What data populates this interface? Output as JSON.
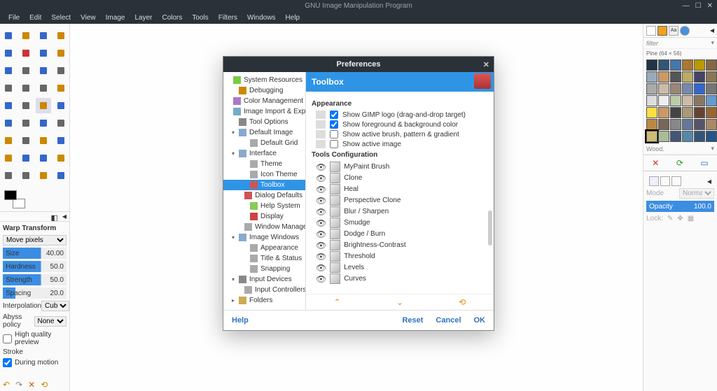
{
  "window": {
    "title": "GNU Image Manipulation Program"
  },
  "menubar": [
    "File",
    "Edit",
    "Select",
    "View",
    "Image",
    "Layer",
    "Colors",
    "Tools",
    "Filters",
    "Windows",
    "Help"
  ],
  "tool_options": {
    "title": "Warp Transform",
    "move": "Move pixels",
    "size_label": "Size",
    "size_val": "40.00",
    "hardness_label": "Hardness",
    "hardness_val": "50.0",
    "strength_label": "Strength",
    "strength_val": "50.0",
    "spacing_label": "Spacing",
    "spacing_val": "20.0",
    "interp_label": "Interpolation",
    "interp_val": "Cubic",
    "abyss_label": "Abyss policy",
    "abyss_val": "None",
    "hq_label": "High quality preview",
    "stroke_label": "Stroke",
    "during_label": "During motion"
  },
  "right": {
    "filter_label": "filter",
    "pattern_title": "Pine (64 × 56)",
    "pattern_name": "Wood.",
    "mode_label": "Mode",
    "mode_val": "Normal",
    "opacity_label": "Opacity",
    "opacity_val": "100.0",
    "lock_label": "Lock:"
  },
  "prefs": {
    "title": "Preferences",
    "tree": [
      {
        "label": "System Resources",
        "level": 0
      },
      {
        "label": "Debugging",
        "level": 0
      },
      {
        "label": "Color Management",
        "level": 0
      },
      {
        "label": "Image Import & Export",
        "level": 0
      },
      {
        "label": "Tool Options",
        "level": 0
      },
      {
        "label": "Default Image",
        "level": 0,
        "exp": "▾"
      },
      {
        "label": "Default Grid",
        "level": 1
      },
      {
        "label": "Interface",
        "level": 0,
        "exp": "▾"
      },
      {
        "label": "Theme",
        "level": 1
      },
      {
        "label": "Icon Theme",
        "level": 1
      },
      {
        "label": "Toolbox",
        "level": 1,
        "active": true
      },
      {
        "label": "Dialog Defaults",
        "level": 1
      },
      {
        "label": "Help System",
        "level": 1
      },
      {
        "label": "Display",
        "level": 1
      },
      {
        "label": "Window Management",
        "level": 1
      },
      {
        "label": "Image Windows",
        "level": 0,
        "exp": "▾"
      },
      {
        "label": "Appearance",
        "level": 1
      },
      {
        "label": "Title & Status",
        "level": 1
      },
      {
        "label": "Snapping",
        "level": 1
      },
      {
        "label": "Input Devices",
        "level": 0,
        "exp": "▾"
      },
      {
        "label": "Input Controllers",
        "level": 1
      },
      {
        "label": "Folders",
        "level": 0,
        "exp": "▸"
      }
    ],
    "header": "Toolbox",
    "appearance_title": "Appearance",
    "appearance": [
      {
        "label": "Show GIMP logo (drag-and-drop target)",
        "checked": true
      },
      {
        "label": "Show foreground & background color",
        "checked": true
      },
      {
        "label": "Show active brush, pattern & gradient",
        "checked": false
      },
      {
        "label": "Show active image",
        "checked": false
      }
    ],
    "tools_title": "Tools Configuration",
    "tools": [
      "MyPaint Brush",
      "Clone",
      "Heal",
      "Perspective Clone",
      "Blur / Sharpen",
      "Smudge",
      "Dodge / Burn",
      "Brightness-Contrast",
      "Threshold",
      "Levels",
      "Curves"
    ],
    "footer": {
      "help": "Help",
      "reset": "Reset",
      "cancel": "Cancel",
      "ok": "OK"
    }
  }
}
